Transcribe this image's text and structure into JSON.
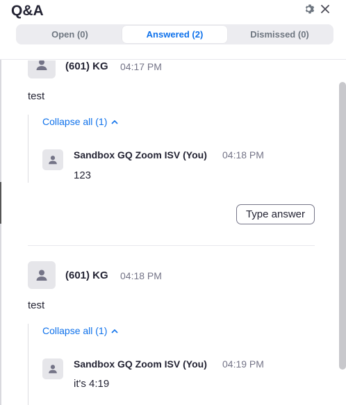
{
  "header": {
    "title": "Q&A",
    "settings_icon": "gear-icon",
    "close_icon": "close-icon"
  },
  "tabs": [
    {
      "label": "Open (0)",
      "active": false
    },
    {
      "label": "Answered (2)",
      "active": true
    },
    {
      "label": "Dismissed (0)",
      "active": false
    }
  ],
  "questions": [
    {
      "author": "(601) KG",
      "time": "04:17 PM",
      "text": "test",
      "collapse_label": "Collapse all (1)",
      "answer": {
        "author": "Sandbox GQ Zoom ISV (You)",
        "time": "04:18 PM",
        "text": "123"
      },
      "type_answer_label": "Type answer"
    },
    {
      "author": "(601) KG",
      "time": "04:18 PM",
      "text": "test",
      "collapse_label": "Collapse all (1)",
      "answer": {
        "author": "Sandbox GQ Zoom ISV (You)",
        "time": "04:19 PM",
        "text": "it's 4:19"
      }
    }
  ],
  "colors": {
    "accent": "#0e71eb",
    "text": "#232333",
    "muted": "#747487"
  }
}
